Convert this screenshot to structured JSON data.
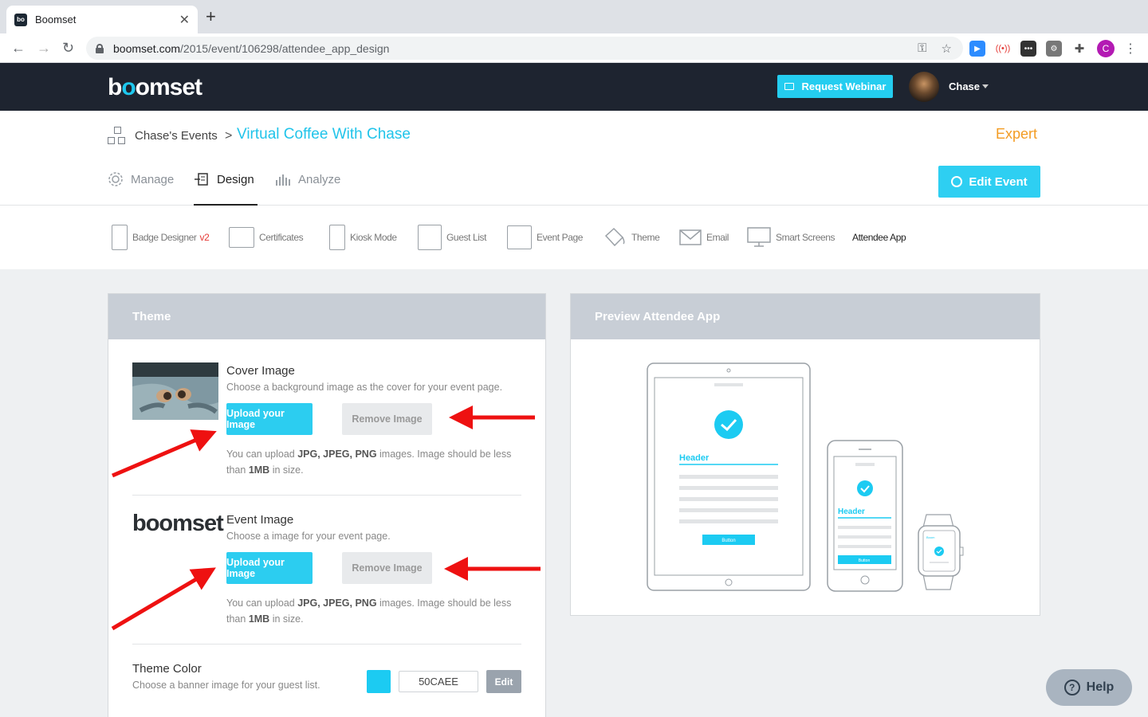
{
  "browser": {
    "tab_title": "Boomset",
    "favicon_text": "bo",
    "url_domain": "boomset.com",
    "url_path": "/2015/event/106298/attendee_app_design",
    "profile_initial": "C"
  },
  "header": {
    "logo": {
      "b": "b",
      "o1": "o",
      "o2": "o",
      "rest": "mset"
    },
    "request_webinar_label": "Request Webinar",
    "user_name": "Chase"
  },
  "breadcrumb": {
    "events_label": "Chase's Events",
    "separator": ">",
    "event_title": "Virtual Coffee With Chase"
  },
  "plan_label": "Expert",
  "main_tabs": [
    {
      "label": "Manage",
      "icon": "gear-icon",
      "active": false
    },
    {
      "label": "Design",
      "icon": "design-icon",
      "active": true
    },
    {
      "label": "Analyze",
      "icon": "bar-chart-icon",
      "active": false
    }
  ],
  "edit_event_label": "Edit Event",
  "sub_nav": [
    {
      "label": "Badge Designer",
      "badge": "v2",
      "icon": "badge-icon"
    },
    {
      "label": "Certificates",
      "icon": "certificate-icon"
    },
    {
      "label": "Kiosk Mode",
      "icon": "kiosk-icon"
    },
    {
      "label": "Guest List",
      "icon": "guest-list-icon"
    },
    {
      "label": "Event Page",
      "icon": "event-page-icon"
    },
    {
      "label": "Theme",
      "icon": "paint-bucket-icon"
    },
    {
      "label": "Email",
      "icon": "envelope-icon"
    },
    {
      "label": "Smart Screens",
      "icon": "monitor-icon"
    },
    {
      "label": "Attendee App",
      "icon": null,
      "active": true
    }
  ],
  "theme_panel": {
    "title": "Theme",
    "cover_image": {
      "title": "Cover Image",
      "description": "Choose a background image as the cover for your event page.",
      "upload_label": "Upload your Image",
      "remove_label": "Remove Image",
      "note_prefix": "You can upload ",
      "note_formats": "JPG, JPEG, PNG",
      "note_mid": " images. Image should be less than ",
      "note_size": "1MB",
      "note_suffix": " in size."
    },
    "event_image": {
      "logo_text": "boomset",
      "title": "Event Image",
      "description": "Choose a image for your event page.",
      "upload_label": "Upload your Image",
      "remove_label": "Remove Image",
      "note_prefix": "You can upload ",
      "note_formats": "JPG, JPEG, PNG",
      "note_mid": " images. Image should be less than ",
      "note_size": "1MB",
      "note_suffix": " in size."
    },
    "theme_color": {
      "title": "Theme Color",
      "description": "Choose a banner image for your guest list.",
      "value": "50CAEE",
      "swatch_color": "#1ccbf2",
      "edit_label": "Edit"
    }
  },
  "preview_panel": {
    "title": "Preview Attendee App",
    "tablet_header": "Header",
    "tablet_button": "Button",
    "phone_header": "Header",
    "phone_button": "Button",
    "watch_header": "Boom"
  },
  "help_label": "Help",
  "colors": {
    "accent": "#2ccdf0",
    "dark_header": "#1e2430",
    "expert_orange": "#f39c23",
    "annotation_arrow": "#ee1111"
  }
}
